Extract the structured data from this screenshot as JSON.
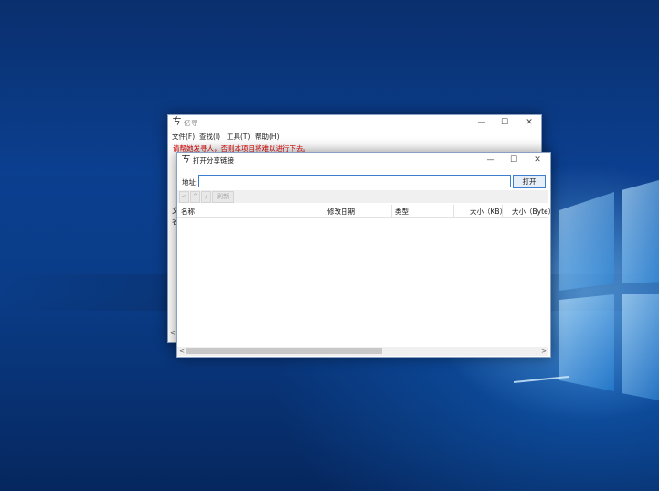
{
  "background_window": {
    "title": "亿寻",
    "menu": [
      "文件(F)",
      "查找(I)",
      "工具(T)",
      "帮助(H)"
    ],
    "notice": "请帮她发寻人，否则本项目将难以进行下去。",
    "partial_left_text": [
      "文",
      "名"
    ]
  },
  "dialog": {
    "title": "打开分享链接",
    "address_label": "地址:",
    "address_value": "",
    "open_button": "打开",
    "toolbar": {
      "back": "<",
      "up": "^",
      "forward": "/",
      "refresh": "刷新"
    },
    "columns": [
      "名称",
      "修改日期",
      "类型",
      "大小（KB）",
      "大小（Byte）"
    ]
  },
  "colors": {
    "notice": "#e00000",
    "accent_border": "#3c7fd0",
    "desktop": "#0b3f8f"
  },
  "icons": [
    "app-icon",
    "minimize-icon",
    "maximize-icon",
    "close-icon",
    "scroll-left-icon",
    "scroll-right-icon",
    "windows-logo-icon"
  ]
}
